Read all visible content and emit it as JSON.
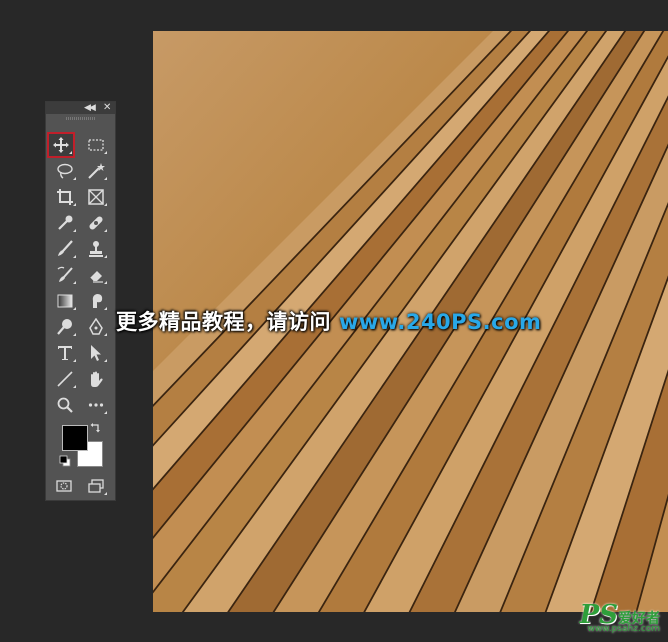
{
  "watermark": {
    "text_cn": "更多精品教程，请访问",
    "url": "www.240PS.com"
  },
  "logo": {
    "ps": "PS",
    "cn": "爱好者",
    "url": "www.psahz.com"
  },
  "toolbar": {
    "collapse_icon": "double-chevron-left-icon",
    "close_icon": "close-icon",
    "selected_tool": "move-tool"
  },
  "colors": {
    "watermark_text": "#ffffff",
    "watermark_url": "#29a8e8",
    "selection_highlight": "#c11f2a",
    "logo": "#2e9e3a",
    "toolbar_bg": "#535353",
    "workspace_bg": "#282828",
    "foreground_color": "#000000",
    "background_color": "#ffffff"
  }
}
